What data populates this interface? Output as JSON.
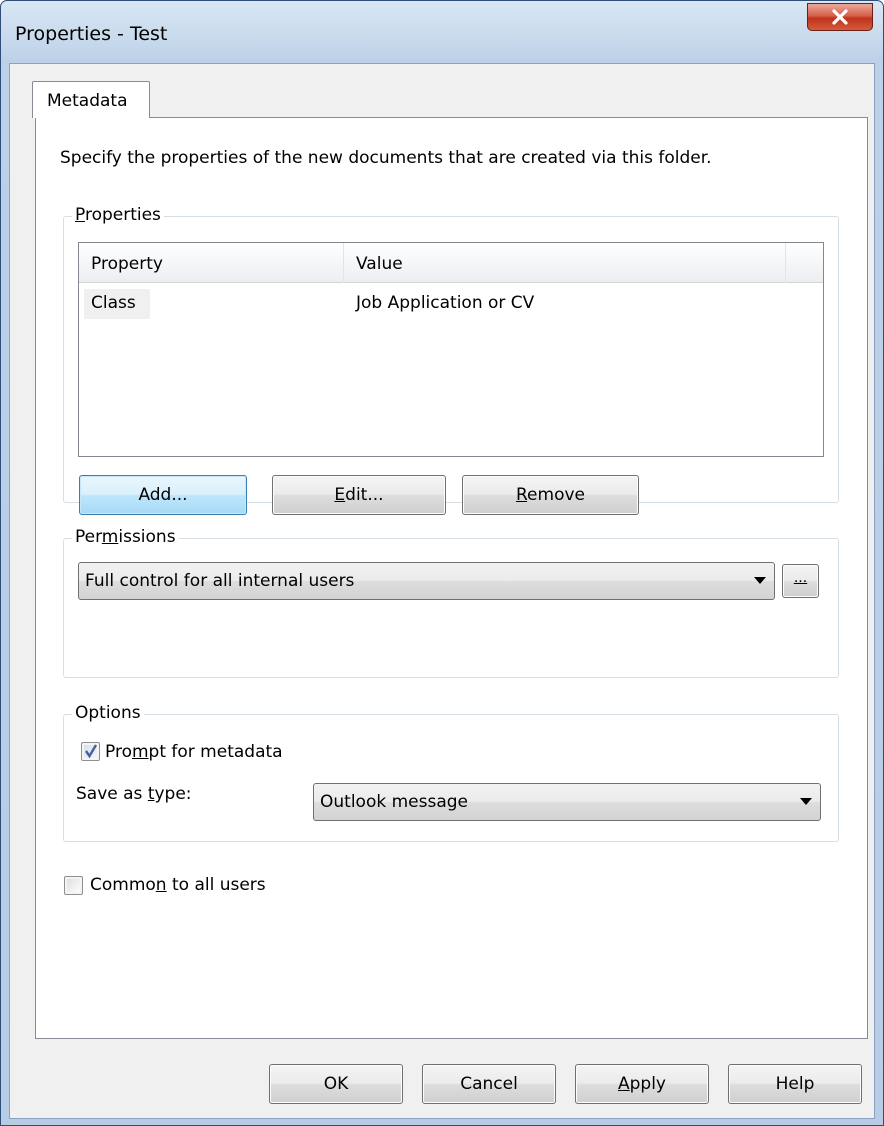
{
  "window": {
    "title": "Properties - Test"
  },
  "tabs": [
    {
      "label": "Metadata"
    }
  ],
  "intro_text": "Specify the properties of the new documents that are created via this folder.",
  "properties": {
    "group_label_pre": "",
    "group_label_ul": "P",
    "group_label_post": "roperties",
    "columns": [
      "Property",
      "Value"
    ],
    "rows": [
      {
        "property": "Class",
        "value": "Job Application or CV"
      }
    ],
    "add_pre": "Add...",
    "edit_ul": "E",
    "edit_post": "dit...",
    "remove_ul": "R",
    "remove_post": "emove"
  },
  "permissions": {
    "group_label_pre": "Per",
    "group_label_ul": "m",
    "group_label_post": "issions",
    "selected": "Full control for all internal users",
    "browse_label": "..."
  },
  "options": {
    "group_label": "Options",
    "prompt_checked": true,
    "prompt_pre": "Pro",
    "prompt_ul": "m",
    "prompt_post": "pt for metadata",
    "save_as_pre": "Save as ",
    "save_as_ul": "t",
    "save_as_post": "ype:",
    "save_as_selected": "Outlook message"
  },
  "common": {
    "checked": false,
    "label_pre": "Commo",
    "label_ul": "n",
    "label_post": " to all users"
  },
  "footer": {
    "ok": "OK",
    "cancel": "Cancel",
    "apply_ul": "A",
    "apply_post": "pply",
    "help": "Help"
  }
}
